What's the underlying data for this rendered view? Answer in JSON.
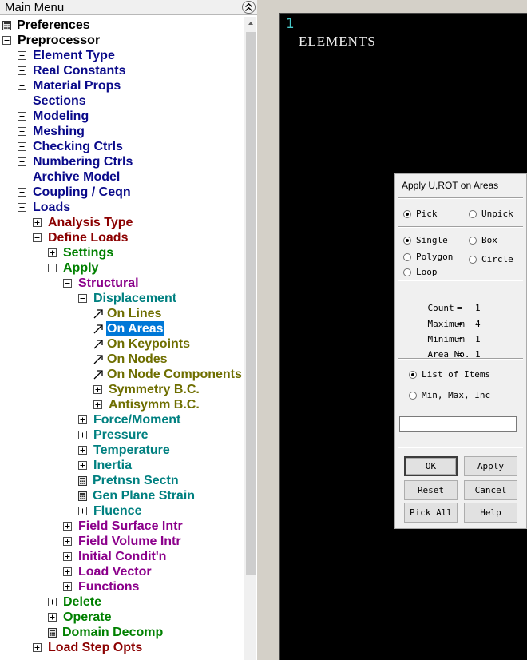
{
  "menu": {
    "title": "Main Menu",
    "tree": [
      {
        "label": "Preferences",
        "icon": "calculator-icon",
        "color": "black",
        "depth": 0,
        "toggle": "calc"
      },
      {
        "label": "Preprocessor",
        "color": "black",
        "depth": 0,
        "toggle": "minus"
      },
      {
        "label": "Element Type",
        "color": "navy",
        "depth": 1,
        "toggle": "plus"
      },
      {
        "label": "Real Constants",
        "color": "navy",
        "depth": 1,
        "toggle": "plus"
      },
      {
        "label": "Material Props",
        "color": "navy",
        "depth": 1,
        "toggle": "plus"
      },
      {
        "label": "Sections",
        "color": "navy",
        "depth": 1,
        "toggle": "plus"
      },
      {
        "label": "Modeling",
        "color": "navy",
        "depth": 1,
        "toggle": "plus"
      },
      {
        "label": "Meshing",
        "color": "navy",
        "depth": 1,
        "toggle": "plus"
      },
      {
        "label": "Checking Ctrls",
        "color": "navy",
        "depth": 1,
        "toggle": "plus"
      },
      {
        "label": "Numbering Ctrls",
        "color": "navy",
        "depth": 1,
        "toggle": "plus"
      },
      {
        "label": "Archive Model",
        "color": "navy",
        "depth": 1,
        "toggle": "plus"
      },
      {
        "label": "Coupling / Ceqn",
        "color": "navy",
        "depth": 1,
        "toggle": "plus"
      },
      {
        "label": "Loads",
        "color": "navy",
        "depth": 1,
        "toggle": "minus"
      },
      {
        "label": "Analysis Type",
        "color": "maroon",
        "depth": 2,
        "toggle": "plus"
      },
      {
        "label": "Define Loads",
        "color": "maroon",
        "depth": 2,
        "toggle": "minus"
      },
      {
        "label": "Settings",
        "color": "green",
        "depth": 3,
        "toggle": "plus"
      },
      {
        "label": "Apply",
        "color": "green",
        "depth": 3,
        "toggle": "minus"
      },
      {
        "label": "Structural",
        "color": "purple",
        "depth": 4,
        "toggle": "minus"
      },
      {
        "label": "Displacement",
        "color": "teal",
        "depth": 5,
        "toggle": "minus"
      },
      {
        "label": "On Lines",
        "color": "olive",
        "depth": 6,
        "toggle": "leaf"
      },
      {
        "label": "On Areas",
        "color": "olive",
        "depth": 6,
        "toggle": "leaf",
        "selected": true
      },
      {
        "label": "On Keypoints",
        "color": "olive",
        "depth": 6,
        "toggle": "leaf"
      },
      {
        "label": "On Nodes",
        "color": "olive",
        "depth": 6,
        "toggle": "leaf"
      },
      {
        "label": "On Node Components",
        "color": "olive",
        "depth": 6,
        "toggle": "leaf"
      },
      {
        "label": "Symmetry B.C.",
        "color": "olive",
        "depth": 6,
        "toggle": "plus"
      },
      {
        "label": "Antisymm B.C.",
        "color": "olive",
        "depth": 6,
        "toggle": "plus"
      },
      {
        "label": "Force/Moment",
        "color": "teal",
        "depth": 5,
        "toggle": "plus"
      },
      {
        "label": "Pressure",
        "color": "teal",
        "depth": 5,
        "toggle": "plus"
      },
      {
        "label": "Temperature",
        "color": "teal",
        "depth": 5,
        "toggle": "plus"
      },
      {
        "label": "Inertia",
        "color": "teal",
        "depth": 5,
        "toggle": "plus"
      },
      {
        "label": "Pretnsn Sectn",
        "color": "teal",
        "depth": 5,
        "toggle": "calc"
      },
      {
        "label": "Gen Plane Strain",
        "color": "teal",
        "depth": 5,
        "toggle": "calc"
      },
      {
        "label": "Fluence",
        "color": "teal",
        "depth": 5,
        "toggle": "plus"
      },
      {
        "label": "Field Surface Intr",
        "color": "purple",
        "depth": 4,
        "toggle": "plus"
      },
      {
        "label": "Field Volume Intr",
        "color": "purple",
        "depth": 4,
        "toggle": "plus"
      },
      {
        "label": "Initial Condit'n",
        "color": "purple",
        "depth": 4,
        "toggle": "plus"
      },
      {
        "label": "Load Vector",
        "color": "purple",
        "depth": 4,
        "toggle": "plus"
      },
      {
        "label": "Functions",
        "color": "purple",
        "depth": 4,
        "toggle": "plus"
      },
      {
        "label": "Delete",
        "color": "green",
        "depth": 3,
        "toggle": "plus"
      },
      {
        "label": "Operate",
        "color": "green",
        "depth": 3,
        "toggle": "plus"
      },
      {
        "label": "Domain Decomp",
        "color": "green",
        "depth": 3,
        "toggle": "calc"
      },
      {
        "label": "Load Step Opts",
        "color": "maroon",
        "depth": 2,
        "toggle": "plus"
      }
    ]
  },
  "colors": {
    "black": "#000000",
    "navy": "#0a0a8a",
    "maroon": "#8b0000",
    "green": "#008000",
    "purple": "#8b008b",
    "teal": "#008080",
    "olive": "#6e6e00",
    "selection": "#0078d7",
    "graphics_bg": "#000000"
  },
  "graphics": {
    "window_number": "1",
    "label": "ELEMENTS"
  },
  "dialog": {
    "title": "Apply U,ROT on Areas",
    "pick_mode": {
      "pick": "Pick",
      "unpick": "Unpick",
      "selected": "Pick"
    },
    "pick_shape": {
      "single": "Single",
      "box": "Box",
      "polygon": "Polygon",
      "circle": "Circle",
      "loop": "Loop",
      "selected": "Single"
    },
    "stats": {
      "count_label": "Count",
      "count": "1",
      "maximum_label": "Maximum",
      "maximum": "4",
      "minimum_label": "Minimum",
      "minimum": "1",
      "area_no_label": "Area No.",
      "area_no": "1",
      "eq": "="
    },
    "input_mode": {
      "list": "List of Items",
      "range": "Min, Max, Inc",
      "selected": "List of Items"
    },
    "input_value": "",
    "buttons": {
      "ok": "OK",
      "apply": "Apply",
      "reset": "Reset",
      "cancel": "Cancel",
      "pick_all": "Pick All",
      "help": "Help"
    }
  }
}
